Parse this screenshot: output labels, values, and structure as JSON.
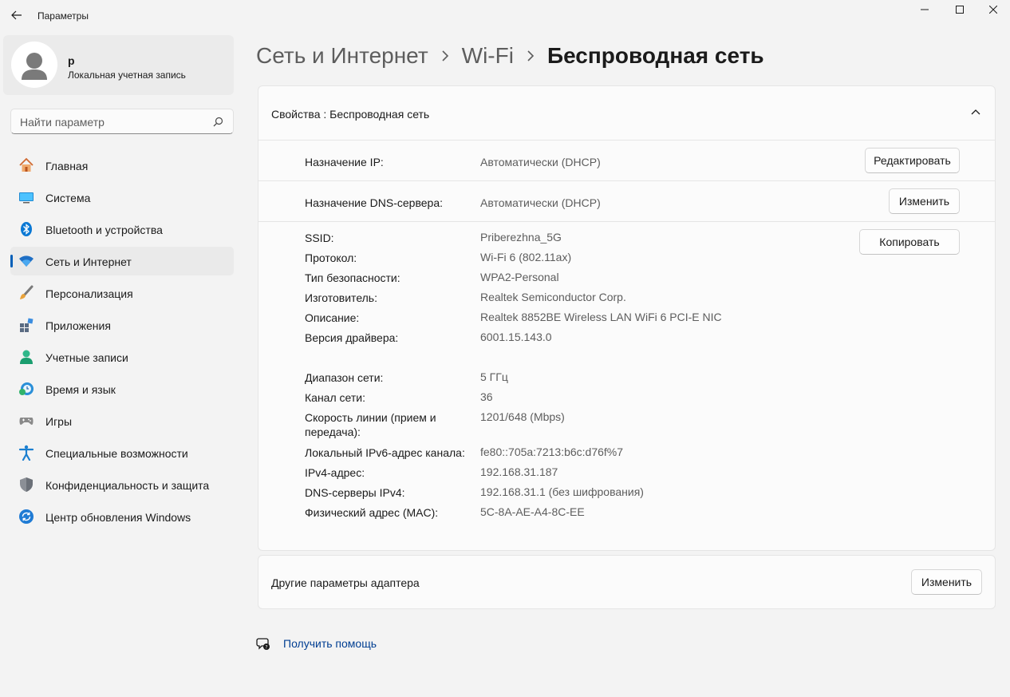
{
  "window": {
    "title": "Параметры"
  },
  "profile": {
    "name": "р",
    "account_type": "Локальная учетная запись"
  },
  "search": {
    "placeholder": "Найти параметр"
  },
  "sidebar": {
    "items": [
      {
        "label": "Главная",
        "icon": "home-icon",
        "active": false
      },
      {
        "label": "Система",
        "icon": "system-icon",
        "active": false
      },
      {
        "label": "Bluetooth и устройства",
        "icon": "bluetooth-icon",
        "active": false
      },
      {
        "label": "Сеть и Интернет",
        "icon": "wifi-icon",
        "active": true
      },
      {
        "label": "Персонализация",
        "icon": "brush-icon",
        "active": false
      },
      {
        "label": "Приложения",
        "icon": "apps-icon",
        "active": false
      },
      {
        "label": "Учетные записи",
        "icon": "accounts-icon",
        "active": false
      },
      {
        "label": "Время и язык",
        "icon": "time-language-icon",
        "active": false
      },
      {
        "label": "Игры",
        "icon": "gamepad-icon",
        "active": false
      },
      {
        "label": "Специальные возможности",
        "icon": "accessibility-icon",
        "active": false
      },
      {
        "label": "Конфиденциальность и защита",
        "icon": "shield-icon",
        "active": false
      },
      {
        "label": "Центр обновления Windows",
        "icon": "update-icon",
        "active": false
      }
    ]
  },
  "breadcrumb": {
    "items": [
      "Сеть и Интернет",
      "Wi-Fi",
      "Беспроводная сеть"
    ]
  },
  "properties_card": {
    "title": "Свойства : Беспроводная сеть",
    "ip_assignment": {
      "label": "Назначение IP:",
      "value": "Автоматически (DHCP)",
      "button": "Редактировать"
    },
    "dns_assignment": {
      "label": "Назначение DNS-сервера:",
      "value": "Автоматически (DHCP)",
      "button": "Изменить"
    },
    "copy_button": "Копировать",
    "properties": [
      {
        "label": "SSID:",
        "value": "Priberezhna_5G"
      },
      {
        "label": "Протокол:",
        "value": "Wi-Fi 6 (802.11ax)"
      },
      {
        "label": "Тип безопасности:",
        "value": "WPA2-Personal"
      },
      {
        "label": "Изготовитель:",
        "value": "Realtek Semiconductor Corp."
      },
      {
        "label": "Описание:",
        "value": "Realtek 8852BE Wireless LAN WiFi 6 PCI-E NIC"
      },
      {
        "label": "Версия драйвера:",
        "value": "6001.15.143.0"
      },
      {
        "label": "Диапазон сети:",
        "value": "5 ГГц"
      },
      {
        "label": "Канал сети:",
        "value": "36"
      },
      {
        "label": "Скорость линии (прием и передача):",
        "value": "1201/648 (Mbps)"
      },
      {
        "label": "Локальный IPv6-адрес канала:",
        "value": "fe80::705a:7213:b6c:d76f%7"
      },
      {
        "label": "IPv4-адрес:",
        "value": "192.168.31.187"
      },
      {
        "label": "DNS-серверы IPv4:",
        "value": "192.168.31.1 (без шифрования)"
      },
      {
        "label": "Физический адрес (MAC):",
        "value": "5C-8A-AE-A4-8C-EE"
      }
    ]
  },
  "adapter_card": {
    "title": "Другие параметры адаптера",
    "button": "Изменить"
  },
  "help": {
    "label": "Получить помощь"
  },
  "colors": {
    "accent": "#005fb8",
    "background": "#f3f3f3",
    "card": "#fbfbfb"
  }
}
